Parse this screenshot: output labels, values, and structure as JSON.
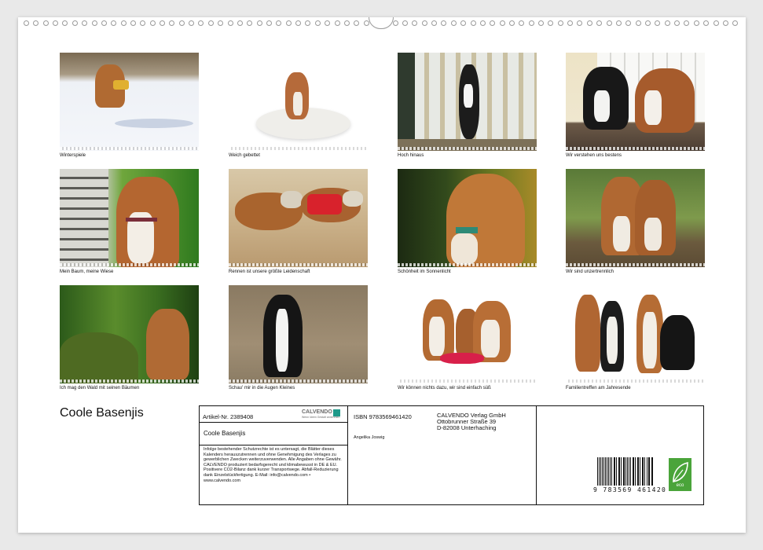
{
  "calendar": {
    "title": "Coole Basenjis"
  },
  "thumbnails": [
    {
      "caption": "Winterspiele"
    },
    {
      "caption": "Weich gebettet"
    },
    {
      "caption": "Hoch hinaus"
    },
    {
      "caption": "Wir verstehen uns bestens"
    },
    {
      "caption": "Mein Baum, meine Wiese"
    },
    {
      "caption": "Rennen ist unsere größte Leidenschaft"
    },
    {
      "caption": "Schönheit im Sonnenlicht"
    },
    {
      "caption": "Wir sind unzertrennlich"
    },
    {
      "caption": "Ich mag den Wald mit seinen Bäumen"
    },
    {
      "caption": "Schau' mir in die Augen Kleines"
    },
    {
      "caption": "Wir können nichts dazu, wir sind einfach süß"
    },
    {
      "caption": "Familientreffen am Jahresende"
    }
  ],
  "info": {
    "artikel": "Artikel-Nr. 2389408",
    "calvendo_logo": "CALVENDO",
    "calvendo_sub": "Wenn Ideen Gestalt annehmen",
    "title": "Coole Basenjis",
    "isbn": "ISBN 9783569461420",
    "author": "Angelika Joswig",
    "publisher_line1": "CALVENDO Verlag GmbH",
    "publisher_line2": "Ottobrunner Straße 39",
    "publisher_line3": "D-82008 Unterhaching",
    "legal": "Infolge bestehender Schutzrechte ist es untersagt, die Blätter dieses Kalenders herauszutrennen und ohne Genehmigung des Verlages zu gewerblichen Zwecken weiterzuverwenden. Alle Angaben ohne Gewähr. CALVENDO produziert bedarfsgerecht und klimabewusst in DE & EU. Positivere CO2-Bilanz dank kurzer Transportwege. Abfall-Reduzierung dank Einzelstückfertigung. E-Mail: info@calvendo.com • www.calvendo.com",
    "barcode_number": "9 783569 461420",
    "eco_label": "eco"
  }
}
